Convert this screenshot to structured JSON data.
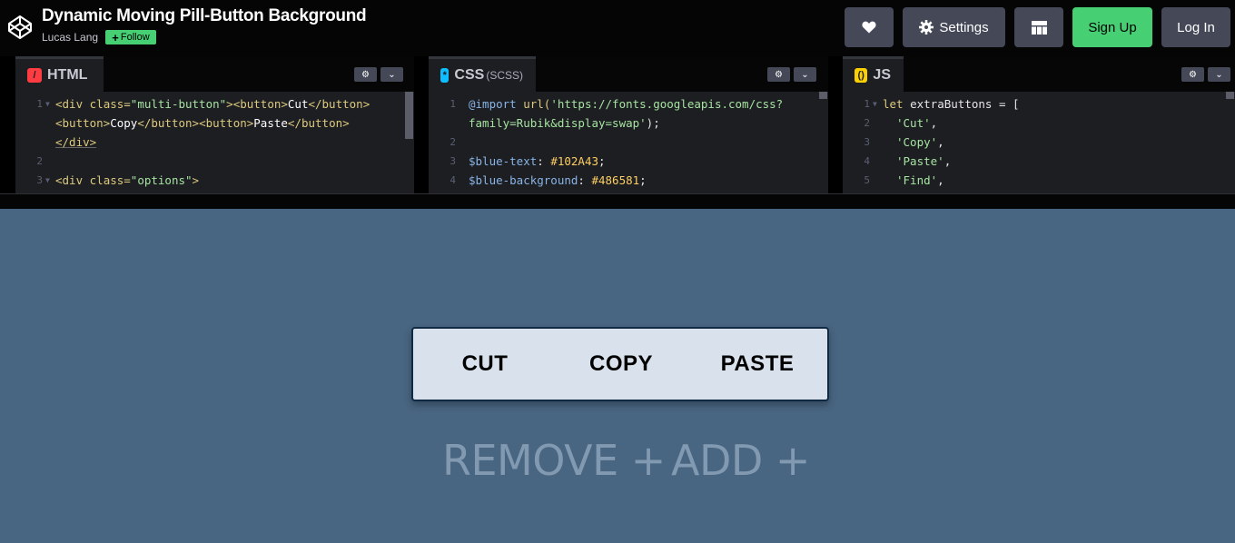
{
  "header": {
    "title": "Dynamic Moving Pill-Button Background",
    "author": "Lucas Lang",
    "follow_label": "Follow",
    "settings_label": "Settings",
    "signup_label": "Sign Up",
    "login_label": "Log In"
  },
  "editors": {
    "html": {
      "tab_label": "HTML",
      "lines": [
        {
          "n": "1",
          "fold": true
        },
        {
          "n": "",
          "fold": false
        },
        {
          "n": "",
          "fold": false
        },
        {
          "n": "2",
          "fold": false
        },
        {
          "n": "3",
          "fold": true
        }
      ],
      "code": {
        "l1_open": "<div ",
        "l1_attr": "class=",
        "l1_str": "\"multi-button\"",
        "l1_gt": ">",
        "l1_b1o": "<button>",
        "l1_cut": "Cut",
        "l1_b1c": "</button>",
        "l2_b2o": "<button>",
        "l2_copy": "Copy",
        "l2_b2c": "</button>",
        "l2_b3o": "<button>",
        "l2_paste": "Paste",
        "l2_b3c": "</button>",
        "l3_close": "</div>",
        "l5_open": "<div ",
        "l5_attr": "class=",
        "l5_str": "\"options\"",
        "l5_gt": ">"
      }
    },
    "css": {
      "tab_label": "CSS",
      "tab_sub": "(SCSS)",
      "lines": [
        "1",
        "",
        "2",
        "3",
        "4"
      ],
      "code": {
        "l1_kw": "@import ",
        "l1_fn": "url(",
        "l1_str": "'https://fonts.googleapis.com/css?",
        "l2_str": "family=Rubik&display=swap'",
        "l2_end": ");",
        "l3_var": "$blue-text",
        "l3_colon": ": ",
        "l3_num": "#102A43",
        "l3_semi": ";",
        "l4_var": "$blue-background",
        "l4_colon": ": ",
        "l4_num": "#486581",
        "l4_semi": ";"
      }
    },
    "js": {
      "tab_label": "JS",
      "lines": [
        "1",
        "2",
        "3",
        "4",
        "5"
      ],
      "code": {
        "l1_kw": "let ",
        "l1_plain": "extraButtons = [",
        "l2": "'Cut'",
        "l3": "'Copy'",
        "l4": "'Paste'",
        "l5": "'Find'",
        "comma": ","
      }
    }
  },
  "preview": {
    "buttons": [
      "CUT",
      "COPY",
      "PASTE"
    ],
    "remove_label": "REMOVE +",
    "add_label": "ADD +"
  },
  "colors": {
    "accent_green": "#47cf73",
    "preview_background": "#486581",
    "pill_background": "#d9e2ec",
    "options_text": "#829ab1"
  }
}
